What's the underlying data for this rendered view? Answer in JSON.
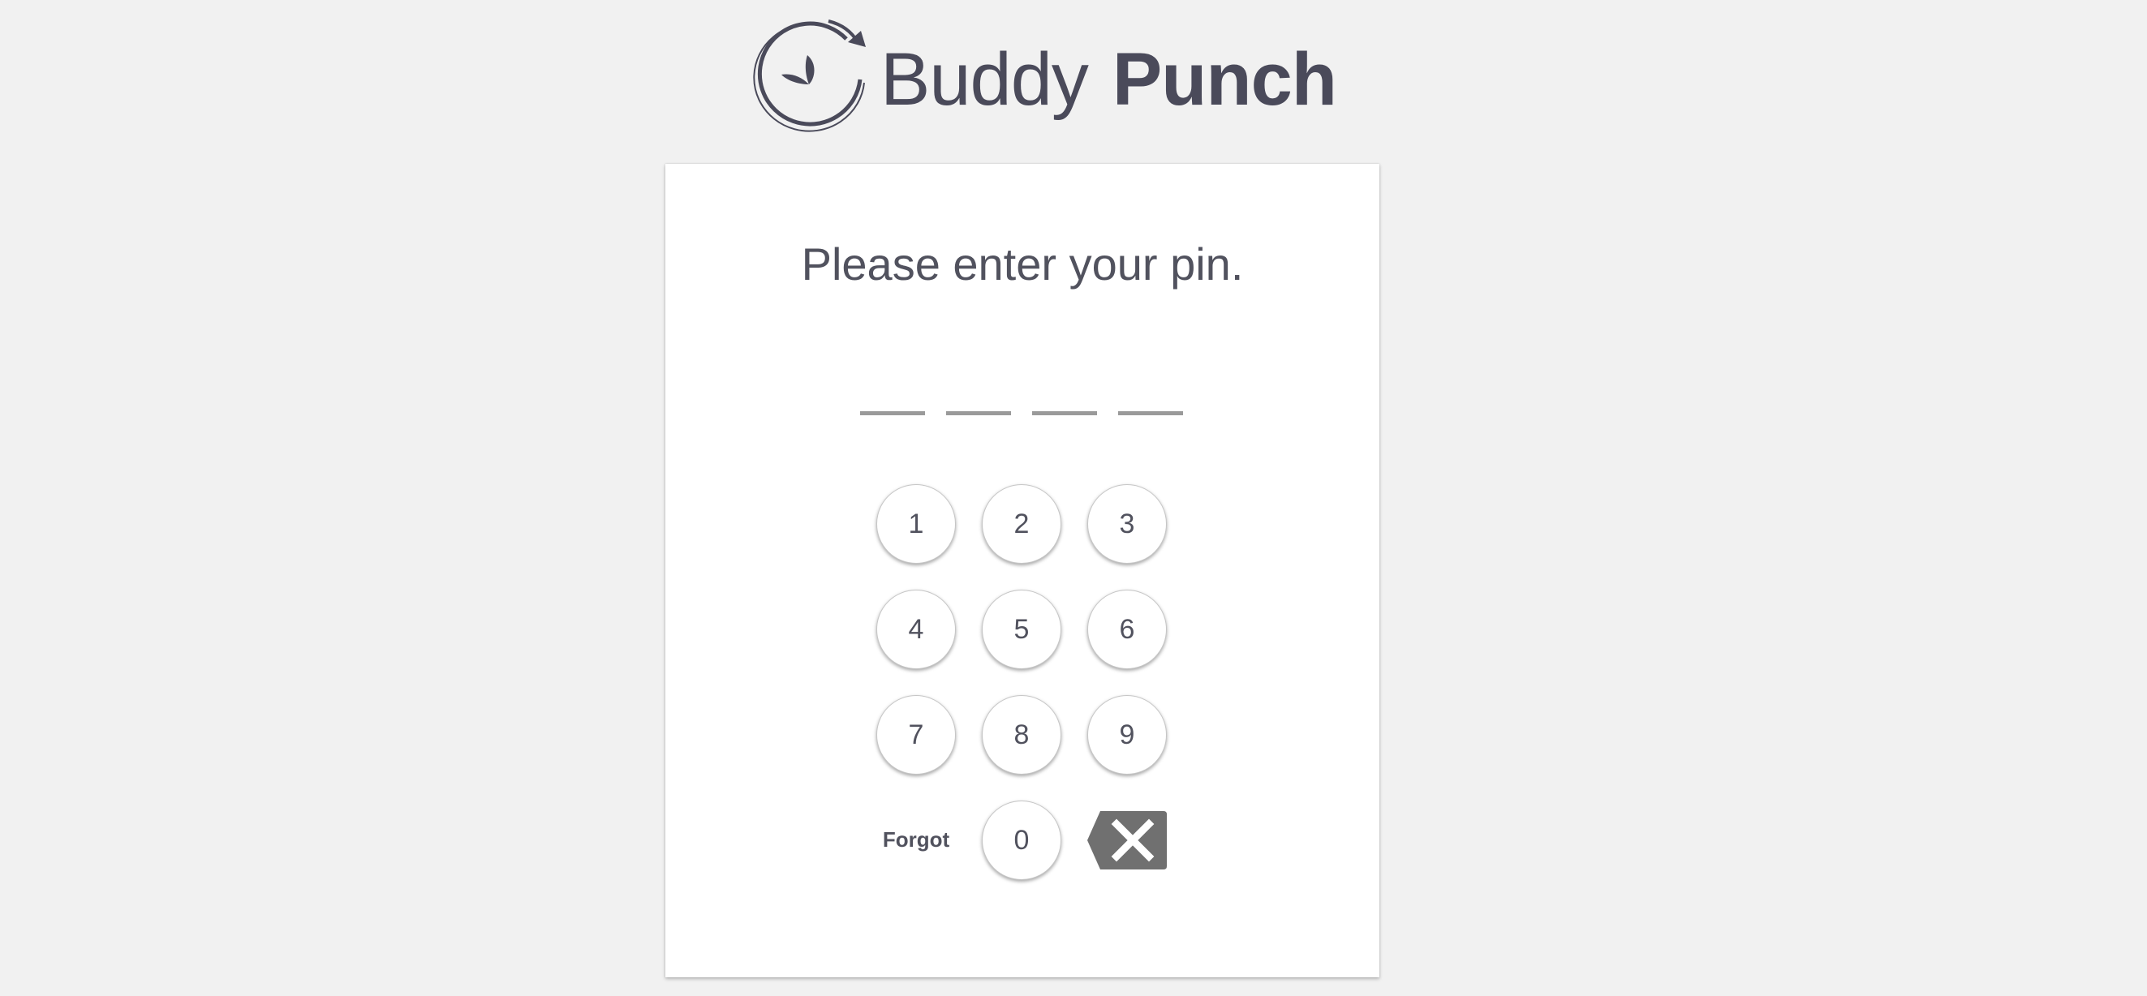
{
  "brand": {
    "name_light": "Buddy",
    "name_bold": "Punch"
  },
  "prompt": "Please enter your pin.",
  "pin": {
    "slot_count": 4,
    "value": ""
  },
  "keypad": {
    "keys": [
      "1",
      "2",
      "3",
      "4",
      "5",
      "6",
      "7",
      "8",
      "9",
      "0"
    ],
    "forgot_label": "Forgot",
    "backspace_icon": "backspace-x-icon"
  },
  "colors": {
    "background": "#f1f1f1",
    "card": "#ffffff",
    "text": "#51525e",
    "slot": "#9a9a9a",
    "backspace": "#707070"
  }
}
